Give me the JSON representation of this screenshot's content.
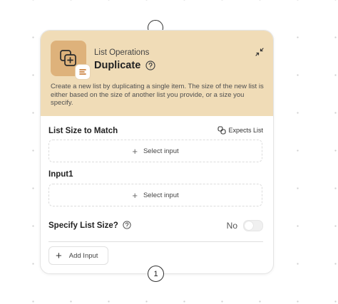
{
  "node": {
    "category": "List Operations",
    "title": "Duplicate",
    "description": "Create a new list by duplicating a single item. The size of the new list is either based on the size of another list you provide, or a size you specify.",
    "header_color": "#f0dcb7",
    "icon_tile_color": "#deb27b",
    "icons": {
      "main": "duplicate-icon",
      "badge": "list-lines-icon",
      "help": "question-circle-icon",
      "collapse": "collapse-arrows-icon"
    }
  },
  "list_size": {
    "label": "List Size to Match",
    "expects_label": "Expects List",
    "expects_icon": "link-icon",
    "select_label": "Select input"
  },
  "input1": {
    "label": "Input1",
    "select_label": "Select input"
  },
  "specify": {
    "label": "Specify List Size?",
    "value": "No",
    "toggle_on": false
  },
  "add_input": {
    "label": "Add Input"
  },
  "ports": {
    "output_count": "1"
  }
}
